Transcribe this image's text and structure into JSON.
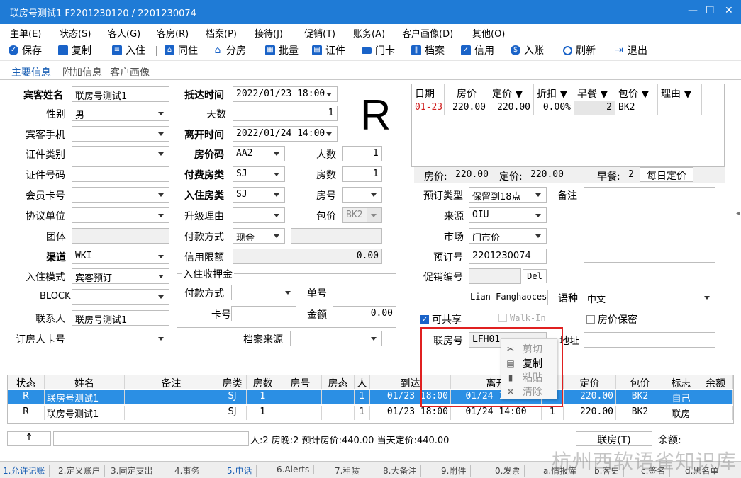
{
  "window": {
    "title": "联房号测试1  F2201230120 / 2201230074",
    "minimize": "—",
    "maximize": "☐",
    "close": "✕"
  },
  "menu": [
    "主单(E)",
    "状态(S)",
    "客人(G)",
    "客房(R)",
    "档案(P)",
    "接待(J)",
    "促销(T)",
    "账务(A)",
    "客户画像(D)",
    "其他(O)"
  ],
  "toolbar": {
    "save": "保存",
    "copy": "复制",
    "checkin": "入住",
    "cohabit": "同住",
    "split_room": "分房",
    "batch": "批量",
    "id_card": "证件",
    "door_card": "门卡",
    "profile": "档案",
    "credit": "信用",
    "post": "入账",
    "refresh": "刷新",
    "exit": "退出"
  },
  "tabs": [
    "主要信息",
    "附加信息",
    "客户画像"
  ],
  "form": {
    "guest_name": {
      "label": "宾客姓名",
      "value": "联房号测试1"
    },
    "gender": {
      "label": "性别",
      "value": "男"
    },
    "mobile": {
      "label": "宾客手机",
      "value": ""
    },
    "id_type": {
      "label": "证件类别",
      "value": ""
    },
    "id_no": {
      "label": "证件号码",
      "value": ""
    },
    "member_card": {
      "label": "会员卡号",
      "value": ""
    },
    "agreement_unit": {
      "label": "协议单位",
      "value": ""
    },
    "group": {
      "label": "团体",
      "value": ""
    },
    "channel": {
      "label": "渠道",
      "value": "WKI"
    },
    "checkin_mode": {
      "label": "入住模式",
      "value": "宾客预订"
    },
    "block": {
      "label": "BLOCK",
      "value": ""
    },
    "contact": {
      "label": "联系人",
      "value": "联房号测试1"
    },
    "booker_card": {
      "label": "订房人卡号",
      "value": ""
    },
    "arrival": {
      "label": "抵达时间",
      "value": "2022/01/23 18:00"
    },
    "nights": {
      "label": "天数",
      "value": "1"
    },
    "departure": {
      "label": "离开时间",
      "value": "2022/01/24 14:00"
    },
    "rate_code": {
      "label": "房价码",
      "value": "AA2"
    },
    "persons": {
      "label": "人数",
      "value": "1"
    },
    "pay_room_type": {
      "label": "付费房类",
      "value": "SJ"
    },
    "rooms": {
      "label": "房数",
      "value": "1"
    },
    "room_type": {
      "label": "入住房类",
      "value": "SJ"
    },
    "room_no": {
      "label": "房号",
      "value": ""
    },
    "upgrade_reason": {
      "label": "升级理由",
      "value": ""
    },
    "package": {
      "label": "包价",
      "value": "BK2"
    },
    "pay_method": {
      "label": "付款方式",
      "value": "现金"
    },
    "credit_limit": {
      "label": "信用限额",
      "value": "0.00"
    },
    "deposit": {
      "legend": "入住收押金",
      "pay_method": {
        "label": "付款方式",
        "value": ""
      },
      "bill_no": {
        "label": "单号",
        "value": ""
      },
      "card_no": {
        "label": "卡号",
        "value": ""
      },
      "amount": {
        "label": "金额",
        "value": "0.00"
      }
    },
    "profile_source": {
      "label": "档案来源",
      "value": ""
    },
    "status_letter": "R"
  },
  "rate_grid": {
    "headers": [
      "日期",
      "房价",
      "定价 ▼",
      "折扣 ▼",
      "早餐 ▼",
      "包价 ▼",
      "理由 ▼"
    ],
    "rows": [
      {
        "date": "01-23",
        "rate": "220.00",
        "price": "220.00",
        "discount": "0.00%",
        "breakfast": "2",
        "package": "BK2",
        "reason": ""
      }
    ],
    "summary": {
      "rate_label": "房价:",
      "rate_value": "220.00",
      "price_label": "定价:",
      "price_value": "220.00",
      "breakfast_label": "早餐:",
      "breakfast_value": "2",
      "daily_button": "每日定价"
    }
  },
  "right_form": {
    "booking_type": {
      "label": "预订类型",
      "value": "保留到18点"
    },
    "remark": {
      "label": "备注",
      "value": ""
    },
    "source": {
      "label": "来源",
      "value": "OIU"
    },
    "market": {
      "label": "市场",
      "value": "门市价"
    },
    "booking_no": {
      "label": "预订号",
      "value": "2201230074"
    },
    "promo_no": {
      "label": "促销编号",
      "value": "",
      "del_button": "Del"
    },
    "salesperson": "Lian Fanghaoces",
    "language": {
      "label": "语种",
      "value": "中文"
    },
    "shareable": {
      "label": "可共享",
      "checked": true
    },
    "walkin": {
      "label": "Walk-In",
      "checked": false
    },
    "rate_secret": {
      "label": "房价保密",
      "checked": false
    },
    "link_no": {
      "label": "联房号",
      "value": "LFH01"
    },
    "address": {
      "label": "地址",
      "value": ""
    }
  },
  "context_menu": [
    {
      "label": "剪切",
      "icon": "scissors-icon",
      "enabled": false
    },
    {
      "label": "复制",
      "icon": "copy-icon",
      "enabled": true
    },
    {
      "label": "粘贴",
      "icon": "paste-icon",
      "enabled": false
    },
    {
      "label": "清除",
      "icon": "clear-icon",
      "enabled": false
    }
  ],
  "grid": {
    "headers": [
      "状态",
      "姓名",
      "备注",
      "房类",
      "房数",
      "房号",
      "房态",
      "人",
      "到达",
      "离开",
      "",
      "定价",
      "包价",
      "标志",
      "余额"
    ],
    "rows": [
      [
        "R",
        "联房号测试1",
        "",
        "SJ",
        "1",
        "",
        "",
        "1",
        "01/23 18:00",
        "01/24 14:00",
        "1",
        "220.00",
        "BK2",
        "自己",
        ""
      ],
      [
        "R",
        "联房号测试1",
        "",
        "SJ",
        "1",
        "",
        "",
        "1",
        "01/23 18:00",
        "01/24 14:00",
        "1",
        "220.00",
        "BK2",
        "联房",
        ""
      ]
    ]
  },
  "status": {
    "up_button": "↑",
    "summary": "人:2  房晚:2  预计房价:440.00  当天定价:440.00",
    "link_button": "联房(T)",
    "balance_label": "余额:"
  },
  "bottom_tabs": [
    "1.允许记账",
    "2.定义账户",
    "3.固定支出",
    "4.事务",
    "5.电话",
    "6.Alerts",
    "7.租赁",
    "8.大备注",
    "9.附件",
    "0.发票",
    "a.情报库",
    "b.客史",
    "c.签名",
    "d.黑名单"
  ],
  "watermark": "杭州西软语雀知识库"
}
